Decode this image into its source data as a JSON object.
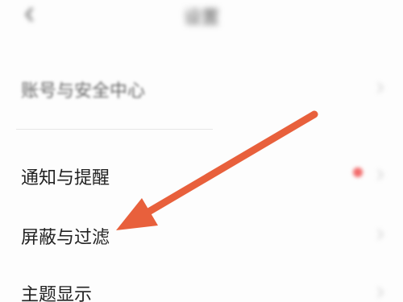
{
  "header": {
    "title": "设置",
    "back_icon": "chevron-left-icon"
  },
  "menu": {
    "items": [
      {
        "label": "账号与安全中心"
      },
      {
        "label": "通知与提醒",
        "has_badge_dot": true
      },
      {
        "label": "屏蔽与过滤"
      },
      {
        "label": "主题显示"
      }
    ]
  },
  "annotation": {
    "type": "arrow",
    "color": "#e8603c",
    "points_to": "屏蔽与过滤"
  },
  "colors": {
    "badge_dot": "#f26a6a",
    "text_primary": "#222222",
    "divider": "#e6e6e6"
  }
}
